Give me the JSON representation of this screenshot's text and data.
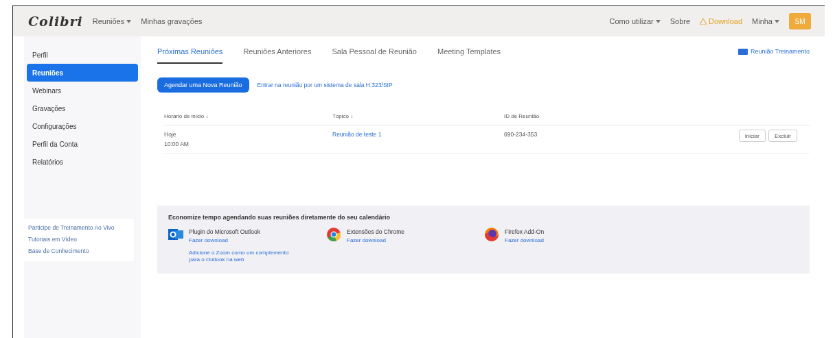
{
  "header": {
    "logo": "Colibri",
    "nav": [
      {
        "label": "Reuniões",
        "dropdown": true
      },
      {
        "label": "Minhas gravações",
        "dropdown": false
      }
    ],
    "right": [
      {
        "kind": "menu",
        "label": "Como utilizar"
      },
      {
        "kind": "link",
        "label": "Sobre"
      },
      {
        "kind": "download",
        "label": "Download"
      },
      {
        "kind": "menu",
        "label": "Minha"
      }
    ],
    "avatar": "SM"
  },
  "sidebar": {
    "items": [
      {
        "label": "Perfil",
        "selected": false
      },
      {
        "label": "Reuniões",
        "selected": true
      },
      {
        "label": "Webinars",
        "selected": false
      },
      {
        "label": "Gravações",
        "selected": false
      },
      {
        "label": "Configurações",
        "selected": false
      },
      {
        "label": "Perfil da Conta",
        "selected": false
      },
      {
        "label": "Relatórios",
        "selected": false
      }
    ],
    "links": [
      "Participe de Treinamento Ao Vivo",
      "Tutoriais em Vídeo",
      "Base de Conhecimento"
    ]
  },
  "tabs": [
    {
      "label": "Próximas Reuniões",
      "selected": true
    },
    {
      "label": "Reuniões Anteriores",
      "selected": false
    },
    {
      "label": "Sala Pessoal de Reunião",
      "selected": false
    },
    {
      "label": "Meeting Templates",
      "selected": false
    }
  ],
  "training_link": "Reunião Treinamento",
  "schedule_button": "Agendar uma Nova Reunião",
  "room_link": "Entrar na reunião por um sistema de sala H.323/SIP",
  "table": {
    "columns": [
      "Horário de início ↓",
      "Tópico ↓",
      "ID de Reunião"
    ],
    "rows": [
      {
        "date": "Hoje",
        "time": "10:00 AM",
        "topic": "Reunião de teste 1",
        "id": "690-234-353",
        "actions": [
          "Iniciar",
          "Excluir"
        ]
      }
    ]
  },
  "calendar_panel": {
    "title": "Economize tempo agendando suas reuniões diretamente do seu calendário",
    "items": [
      {
        "kind": "outlook",
        "name": "Plugin do Microsoft Outlook",
        "link": "Fazer download",
        "note": "Adicione o Zoom como um complemento para o Outlook na web"
      },
      {
        "kind": "chrome",
        "name": "Extensões do Chrome",
        "link": "Fazer download"
      },
      {
        "kind": "firefox",
        "name": "Firefox Add-On",
        "link": "Fazer download"
      }
    ]
  }
}
